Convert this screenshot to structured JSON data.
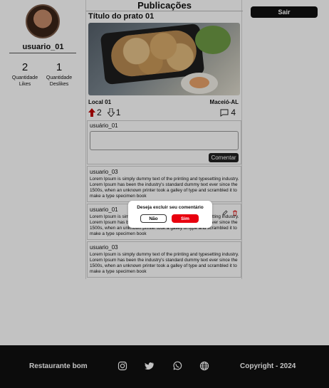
{
  "profile": {
    "username": "usuario_01",
    "stats": [
      {
        "value": "2",
        "label": "Quantidade Likes"
      },
      {
        "value": "1",
        "label": "Quantidade Deslikes"
      }
    ]
  },
  "feed": {
    "title": "Publicações",
    "post": {
      "title": "Título do prato 01",
      "local": "Local 01",
      "city": "Maceió-AL",
      "likes": "2",
      "dislikes": "1",
      "comments": "4"
    },
    "compose": {
      "user": "usuário_01",
      "placeholder": "",
      "button": "Comentar"
    },
    "comments": [
      {
        "author": "usuario_03",
        "text": "Lorem Ipsum is simply dummy text of the printing and typesetting industry. Lorem Ipsum has been the industry's standard dummy text ever since the 1500s, when an unknown printer took a galley of type and scrambled it to make a type specimen book"
      },
      {
        "author": "usuario_01",
        "text": "Lorem Ipsum is simply dummy text of the printing and typesetting industry. Lorem Ipsum has been the industry's standard dummy text ever since the 1500s, when an unknown printer took a galley of type and scrambled it to make a type specimen book"
      },
      {
        "author": "usuario_03",
        "text": "Lorem Ipsum is simply dummy text of the printing and typesetting industry. Lorem Ipsum has been the industry's standard dummy text ever since the 1500s, when an unknown printer took a galley of type and scrambled it to make a type specimen book"
      }
    ]
  },
  "header": {
    "logout": "Sair"
  },
  "footer": {
    "brand": "Restaurante bom",
    "copyright": "Copyright - 2024",
    "icons": [
      "instagram-icon",
      "twitter-icon",
      "whatsapp-icon",
      "globe-icon"
    ]
  },
  "modal": {
    "question": "Deseja excluir seu comentário",
    "no": "Não",
    "yes": "Sim"
  },
  "colors": {
    "accent_red": "#e8000e",
    "dark": "#111111",
    "like_red": "#c00000"
  }
}
